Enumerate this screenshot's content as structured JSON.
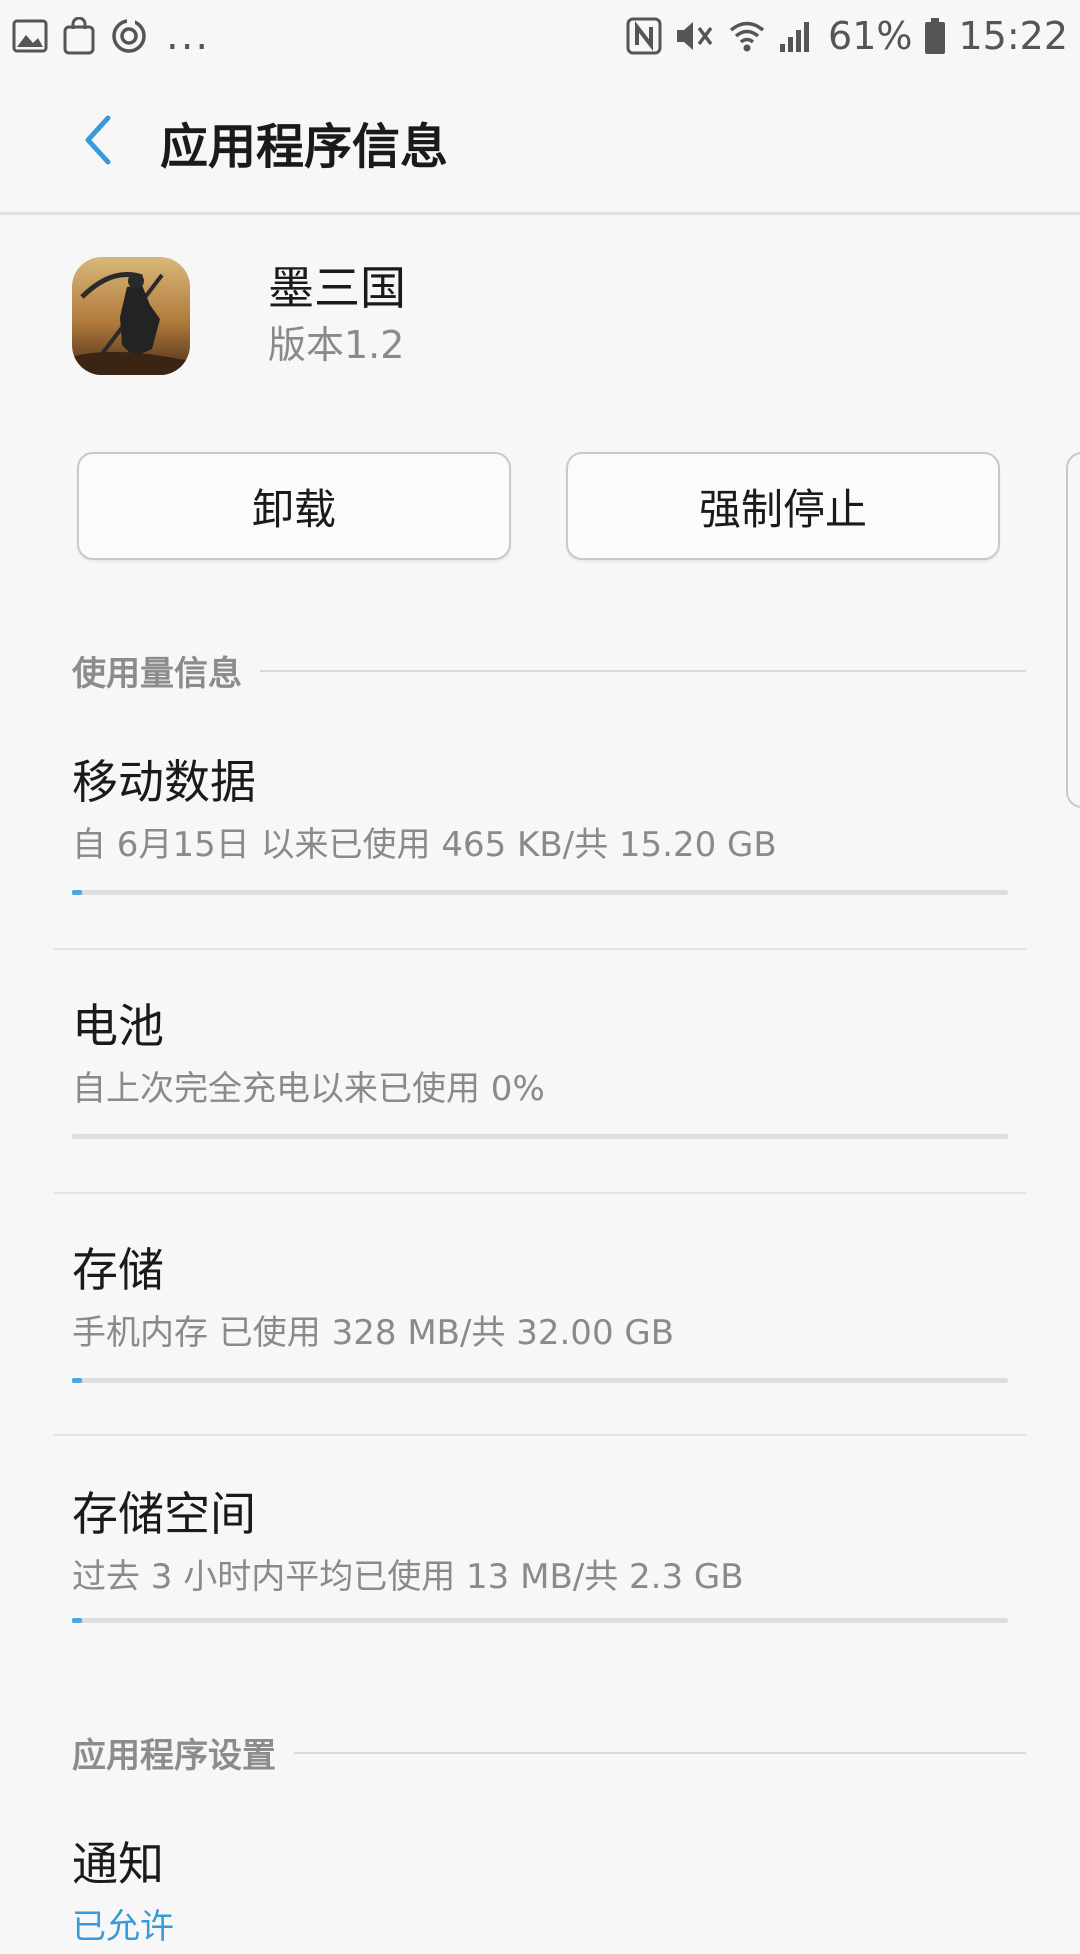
{
  "status_bar": {
    "battery": "61%",
    "time": "15:22",
    "left_icons": [
      "gallery-icon",
      "shopping-bag-icon",
      "sync-icon"
    ],
    "overflow": "...",
    "right_icons": [
      "nfc-icon",
      "mute-icon",
      "wifi-icon",
      "signal-icon",
      "battery-icon"
    ]
  },
  "header": {
    "title": "应用程序信息"
  },
  "app": {
    "name": "墨三国",
    "version": "版本1.2"
  },
  "buttons": {
    "uninstall": "卸载",
    "force_stop": "强制停止"
  },
  "sections": {
    "usage": "使用量信息",
    "settings": "应用程序设置"
  },
  "items": {
    "mobile_data": {
      "title": "移动数据",
      "sub": "自 6月15日 以来已使用 465 KB/共 15.20 GB",
      "fraction": 3e-05
    },
    "battery": {
      "title": "电池",
      "sub": "自上次完全充电以来已使用 0%",
      "fraction": 0.0
    },
    "storage": {
      "title": "存储",
      "sub": "手机内存 已使用 328 MB/共 32.00 GB",
      "fraction": 0.01
    },
    "memory": {
      "title": "存储空间",
      "sub": "过去 3 小时内平均已使用 13 MB/共 2.3 GB",
      "fraction": 0.0056
    },
    "notifications": {
      "title": "通知",
      "sub": "已允许"
    }
  },
  "colors": {
    "accent": "#4aa9de",
    "back_arrow": "#3a9ad9"
  }
}
